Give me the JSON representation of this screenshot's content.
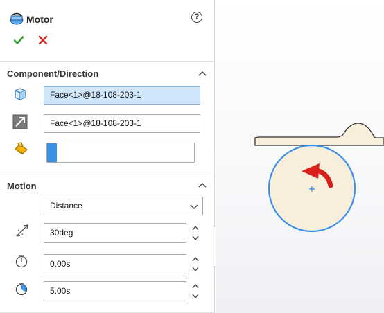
{
  "panel": {
    "title": "Motor",
    "help_glyph": "?"
  },
  "component_direction": {
    "title": "Component/Direction",
    "component_face": "Face<1>@18-108-203-1",
    "direction_face": "Face<1>@18-108-203-1",
    "load_bearing_value": ""
  },
  "motion": {
    "title": "Motion",
    "type_selected": "Distance",
    "distance": "30deg",
    "start_time": "0.00s",
    "duration": "5.00s"
  },
  "icons": {
    "title": "motor-icon",
    "help": "help-icon",
    "ok": "checkmark-icon",
    "cancel": "close-icon",
    "component": "component-face-icon",
    "direction": "direction-arrow-icon",
    "load_bearing": "load-bearing-faces-icon",
    "distance": "distance-icon",
    "start_time": "start-time-icon",
    "duration": "duration-icon"
  },
  "colors": {
    "ok": "#2e9e2e",
    "cancel": "#d2261e",
    "selection": "#cfe6fb",
    "accent_blue": "#3a8fe6",
    "motor_arrow": "#d9211c",
    "part_fill": "#f8eedc"
  }
}
